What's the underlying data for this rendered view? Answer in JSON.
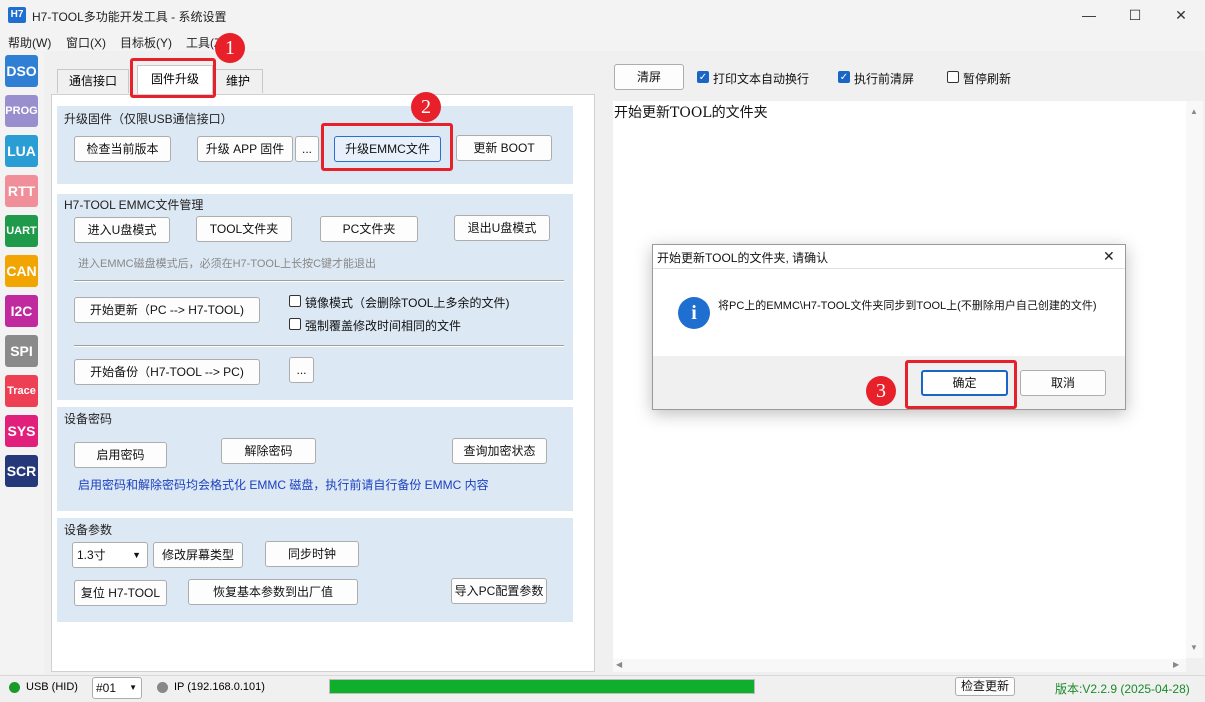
{
  "window": {
    "icon_text": "H7",
    "title": "H7-TOOL多功能开发工具 - 系统设置",
    "minimize": "—",
    "maximize": "☐",
    "close": "✕"
  },
  "menu": [
    "帮助(W)",
    "窗口(X)",
    "目标板(Y)",
    "工具(Z)"
  ],
  "sidebar": [
    {
      "label": "DSO",
      "color": "#2f7fd4"
    },
    {
      "label": "PROG",
      "color": "#9a8fce"
    },
    {
      "label": "LUA",
      "color": "#2a9ed4"
    },
    {
      "label": "RTT",
      "color": "#f08f9a"
    },
    {
      "label": "UART",
      "color": "#1f9a4a"
    },
    {
      "label": "CAN",
      "color": "#f2a400"
    },
    {
      "label": "I2C",
      "color": "#c02a9e"
    },
    {
      "label": "SPI",
      "color": "#8a8a8a"
    },
    {
      "label": "Trace",
      "color": "#ee4055"
    },
    {
      "label": "SYS",
      "color": "#e0207a"
    },
    {
      "label": "SCR",
      "color": "#24387a"
    }
  ],
  "tabs": [
    "通信接口",
    "固件升级",
    "维护"
  ],
  "firmware": {
    "title": "升级固件（仅限USB通信接口）",
    "check_version": "检查当前版本",
    "upgrade_app": "升级 APP 固件",
    "more": "...",
    "upgrade_emmc": "升级EMMC文件",
    "update_boot": "更新 BOOT"
  },
  "emmc": {
    "title": "H7-TOOL EMMC文件管理",
    "enter_u": "进入U盘模式",
    "tool_folder": "TOOL文件夹",
    "pc_folder": "PC文件夹",
    "exit_u": "退出U盘模式",
    "hint": "进入EMMC磁盘模式后，必须在H7-TOOL上长按C键才能退出",
    "start_update": "开始更新（PC --> H7-TOOL)",
    "mirror_mode": "镜像模式（会删除TOOL上多余的文件)",
    "force_overwrite": "强制覆盖修改时间相同的文件",
    "start_backup": "开始备份（H7-TOOL --> PC)",
    "more": "..."
  },
  "password": {
    "title": "设备密码",
    "enable": "启用密码",
    "disable": "解除密码",
    "query": "查询加密状态",
    "note": "启用密码和解除密码均会格式化 EMMC 磁盘，执行前请自行备份 EMMC 内容",
    "note_color": "#1a3fbf"
  },
  "params": {
    "title": "设备参数",
    "screen_size": "1.3寸",
    "modify_screen": "修改屏幕类型",
    "sync_clock": "同步时钟",
    "reset": "复位 H7-TOOL",
    "restore_defaults": "恢复基本参数到出厂值",
    "import_pc": "导入PC配置参数"
  },
  "right": {
    "clear": "清屏",
    "auto_wrap": "打印文本自动换行",
    "auto_wrap_checked": true,
    "clear_before": "执行前清屏",
    "clear_before_checked": true,
    "pause_refresh": "暂停刷新",
    "pause_refresh_checked": false,
    "log": "开始更新TOOL的文件夹"
  },
  "dialog": {
    "title": "开始更新TOOL的文件夹, 请确认",
    "close": "✕",
    "icon": "i",
    "message": "将PC上的EMMC\\H7-TOOL文件夹同步到TOOL上(不删除用户自己创建的文件)",
    "ok": "确定",
    "cancel": "取消"
  },
  "annotations": {
    "n1": "1",
    "n2": "2",
    "n3": "3"
  },
  "status": {
    "usb": "USB (HID)",
    "device": "#01",
    "ip": "IP (192.168.0.101)",
    "progress": 1.0,
    "check_update": "检查更新",
    "version": "版本:V2.2.9 (2025-04-28)",
    "version_color": "#1a8a2a"
  }
}
